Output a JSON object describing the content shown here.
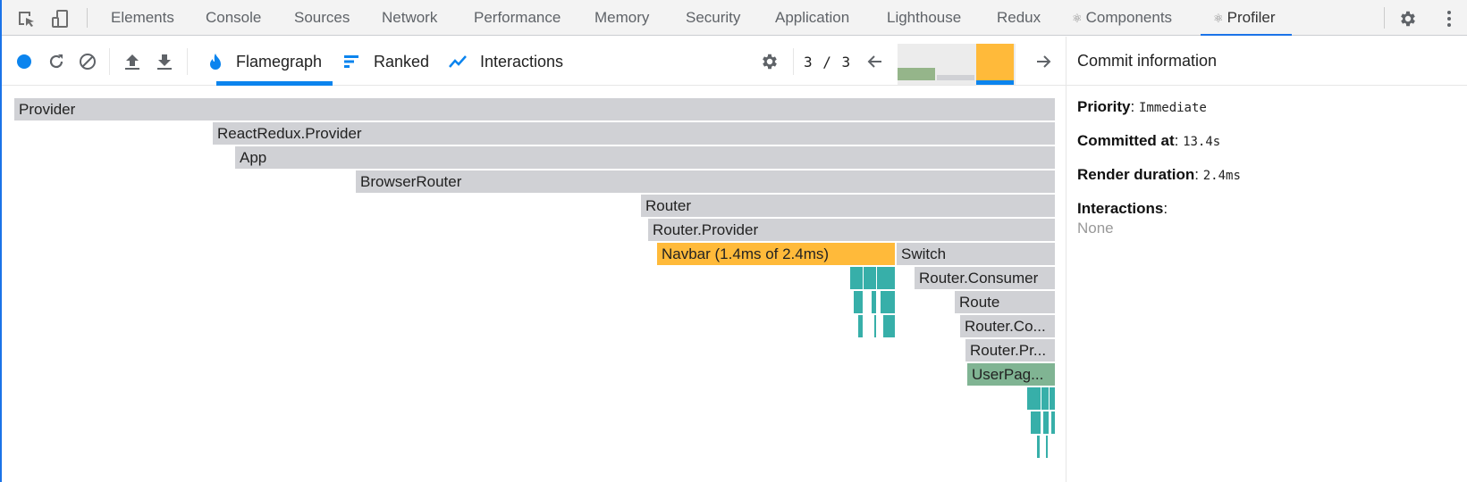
{
  "devtools": {
    "tabs": [
      {
        "label": "Elements"
      },
      {
        "label": "Console"
      },
      {
        "label": "Sources"
      },
      {
        "label": "Network"
      },
      {
        "label": "Performance"
      },
      {
        "label": "Memory"
      },
      {
        "label": "Security"
      },
      {
        "label": "Application"
      },
      {
        "label": "Lighthouse"
      },
      {
        "label": "Redux"
      },
      {
        "label": "Components",
        "icon": "react-icon"
      },
      {
        "label": "Profiler",
        "icon": "react-icon",
        "active": true
      }
    ],
    "react_glyph": "⚛"
  },
  "profiler_toolbar": {
    "tabs": [
      {
        "label": "Flamegraph",
        "icon": "flame-icon",
        "active": true
      },
      {
        "label": "Ranked",
        "icon": "ranked-icon"
      },
      {
        "label": "Interactions",
        "icon": "interactions-icon"
      }
    ],
    "commit_index": "3 / 3",
    "commits": [
      {
        "duration_fraction": 0.35,
        "color": "#95b58a"
      },
      {
        "duration_fraction": 0.15,
        "color": "#d0d1d5"
      },
      {
        "duration_fraction": 1.0,
        "color": "#ffba3a",
        "selected": true
      }
    ]
  },
  "commit_info": {
    "title": "Commit information",
    "priority_label": "Priority",
    "priority_value": "Immediate",
    "committed_at_label": "Committed at",
    "committed_at_value": "13.4s",
    "render_duration_label": "Render duration",
    "render_duration_value": "2.4ms",
    "interactions_label": "Interactions",
    "interactions_value": "None"
  },
  "flamegraph": {
    "colors": {
      "inactive": "#d0d1d5",
      "selected": "#ffba3a",
      "rendered": "#80b493",
      "fast": "#37afa9"
    },
    "nodes": [
      {
        "label": "Provider",
        "depth": 0
      },
      {
        "label": "ReactRedux.Provider",
        "depth": 1
      },
      {
        "label": "App",
        "depth": 2
      },
      {
        "label": "BrowserRouter",
        "depth": 3
      },
      {
        "label": "Router",
        "depth": 4
      },
      {
        "label": "Router.Provider",
        "depth": 5
      },
      {
        "label": "Navbar (1.4ms of 2.4ms)",
        "depth": 6,
        "selected": true
      },
      {
        "label": "Switch",
        "depth": 6
      },
      {
        "label": "Router.Consumer",
        "depth": 7
      },
      {
        "label": "Route",
        "depth": 8
      },
      {
        "label": "Router.Co...",
        "depth": 9
      },
      {
        "label": "Router.Pr...",
        "depth": 10
      },
      {
        "label": "UserPag...",
        "depth": 11,
        "rendered": true
      }
    ]
  }
}
